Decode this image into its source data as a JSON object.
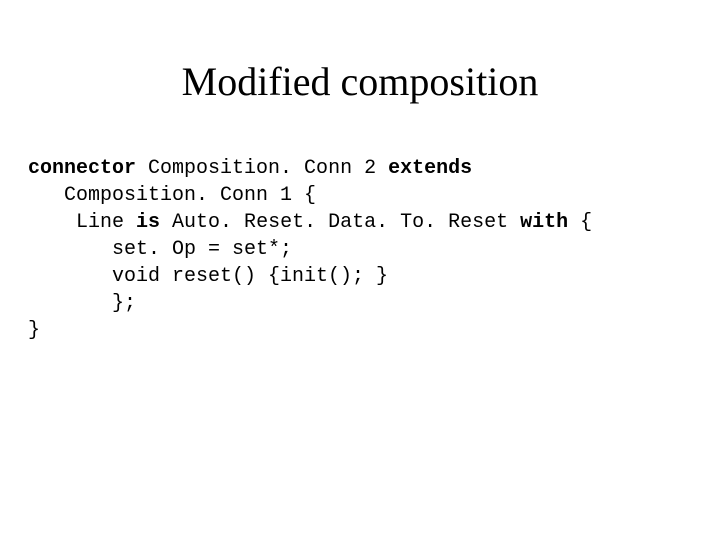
{
  "title": "Modified composition",
  "code": {
    "kw_connector": "connector",
    "class_new": " Composition. Conn 2 ",
    "kw_extends": "extends",
    "class_base": "   Composition. Conn 1 {",
    "line_is_pre": "    Line ",
    "kw_is": "is",
    "line_is_mid": " Auto. Reset. Data. To. Reset ",
    "kw_with": "with",
    "line_is_post": " {",
    "line_setop": "       set. Op = set*;",
    "line_reset": "       void reset() {init(); }",
    "line_close1": "       };",
    "line_close2": "}"
  }
}
